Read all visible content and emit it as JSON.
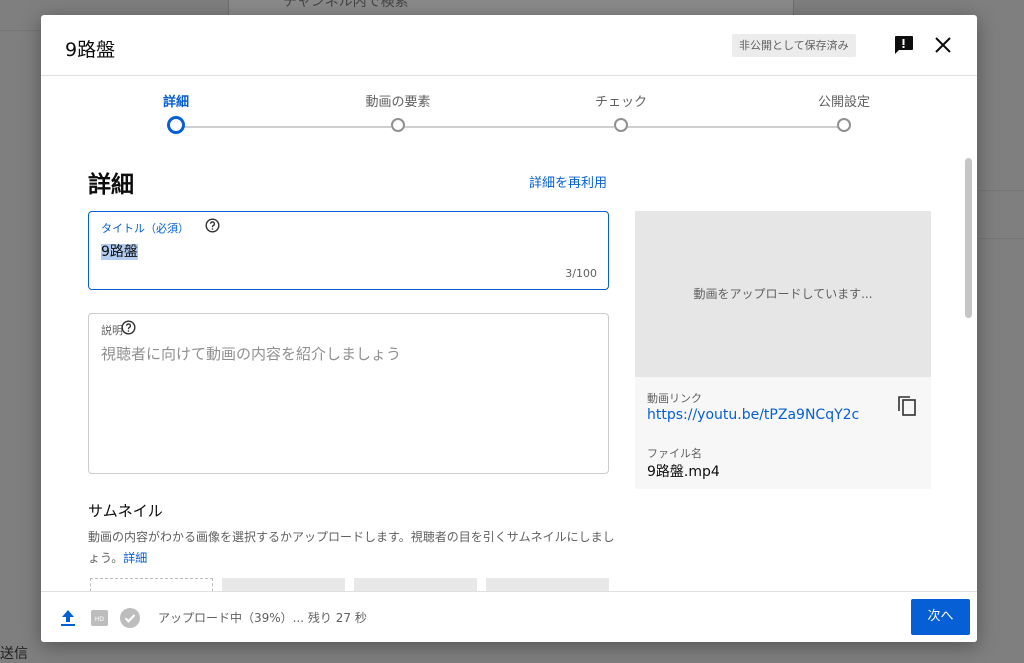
{
  "background": {
    "search_text": "チャンネル内で検索",
    "bottom_left_text": "送信"
  },
  "modal": {
    "title": "9路盤",
    "saved_badge": "非公開として保存済み",
    "icons": {
      "feedback": "feedback-icon",
      "close": "close-icon"
    }
  },
  "stepper": {
    "steps": [
      {
        "label": "詳細",
        "active": true
      },
      {
        "label": "動画の要素",
        "active": false
      },
      {
        "label": "チェック",
        "active": false
      },
      {
        "label": "公開設定",
        "active": false
      }
    ]
  },
  "details": {
    "heading": "詳細",
    "reuse_link": "詳細を再利用",
    "title_field": {
      "label": "タイトル（必須）",
      "value": "9路盤",
      "counter": "3/100"
    },
    "description_field": {
      "label": "説明",
      "placeholder": "視聴者に向けて動画の内容を紹介しましょう"
    },
    "thumbnail": {
      "title": "サムネイル",
      "description": "動画の内容がわかる画像を選択するかアップロードします。視聴者の目を引くサムネイルにしましょう。",
      "more_link": "詳細"
    }
  },
  "preview": {
    "status": "動画をアップロードしています...",
    "link_label": "動画リンク",
    "link": "https://youtu.be/tPZa9NCqY2c",
    "file_label": "ファイル名",
    "file_name": "9路盤.mp4"
  },
  "footer": {
    "status": "アップロード中（39%）... 残り 27 秒",
    "upload_progress_percent": 39,
    "next_button": "次へ"
  },
  "colors": {
    "accent": "#065fd4",
    "overlay": "#7f7f7f"
  }
}
